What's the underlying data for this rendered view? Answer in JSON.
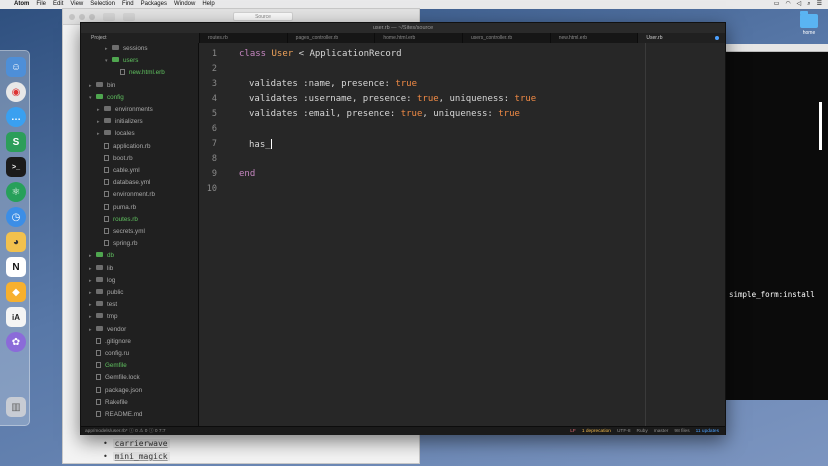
{
  "menubar": {
    "apple": "",
    "app": "Atom",
    "items": [
      "File",
      "Edit",
      "View",
      "Selection",
      "Find",
      "Packages",
      "Window",
      "Help"
    ]
  },
  "background_window": {
    "address": "Source",
    "bullets": [
      "carrierwave",
      "mini_magick"
    ]
  },
  "terminal": {
    "line": "simple_form:install"
  },
  "desktop": {
    "folder_label": "home"
  },
  "atom": {
    "title": "user.rb — ~/Sites/source",
    "project_tab": "Project",
    "tabs": [
      "routes.rb",
      "pages_controller.rb",
      "home.html.erb",
      "users_controller.rb",
      "new.html.erb",
      "User.rb"
    ],
    "tree": [
      {
        "label": "sessions",
        "type": "folder",
        "depth": 2,
        "expanded": false,
        "green": false
      },
      {
        "label": "users",
        "type": "folder",
        "depth": 2,
        "expanded": true,
        "green": true
      },
      {
        "label": "new.html.erb",
        "type": "file",
        "depth": 3,
        "green": true
      },
      {
        "label": "bin",
        "type": "folder",
        "depth": 0,
        "expanded": false,
        "green": false
      },
      {
        "label": "config",
        "type": "folder",
        "depth": 0,
        "expanded": true,
        "green": true
      },
      {
        "label": "environments",
        "type": "folder",
        "depth": 1,
        "expanded": false,
        "green": false
      },
      {
        "label": "initializers",
        "type": "folder",
        "depth": 1,
        "expanded": false,
        "green": false
      },
      {
        "label": "locales",
        "type": "folder",
        "depth": 1,
        "expanded": false,
        "green": false
      },
      {
        "label": "application.rb",
        "type": "file",
        "depth": 1,
        "green": false
      },
      {
        "label": "boot.rb",
        "type": "file",
        "depth": 1,
        "green": false
      },
      {
        "label": "cable.yml",
        "type": "file",
        "depth": 1,
        "green": false
      },
      {
        "label": "database.yml",
        "type": "file",
        "depth": 1,
        "green": false
      },
      {
        "label": "environment.rb",
        "type": "file",
        "depth": 1,
        "green": false
      },
      {
        "label": "puma.rb",
        "type": "file",
        "depth": 1,
        "green": false
      },
      {
        "label": "routes.rb",
        "type": "file",
        "depth": 1,
        "green": true
      },
      {
        "label": "secrets.yml",
        "type": "file",
        "depth": 1,
        "green": false
      },
      {
        "label": "spring.rb",
        "type": "file",
        "depth": 1,
        "green": false
      },
      {
        "label": "db",
        "type": "folder",
        "depth": 0,
        "expanded": false,
        "green": true
      },
      {
        "label": "lib",
        "type": "folder",
        "depth": 0,
        "expanded": false,
        "green": false
      },
      {
        "label": "log",
        "type": "folder",
        "depth": 0,
        "expanded": false,
        "green": false
      },
      {
        "label": "public",
        "type": "folder",
        "depth": 0,
        "expanded": false,
        "green": false
      },
      {
        "label": "test",
        "type": "folder",
        "depth": 0,
        "expanded": false,
        "green": false
      },
      {
        "label": "tmp",
        "type": "folder",
        "depth": 0,
        "expanded": false,
        "green": false
      },
      {
        "label": "vendor",
        "type": "folder",
        "depth": 0,
        "expanded": false,
        "green": false
      },
      {
        "label": ".gitignore",
        "type": "file",
        "depth": 0,
        "green": false
      },
      {
        "label": "config.ru",
        "type": "file",
        "depth": 0,
        "green": false
      },
      {
        "label": "Gemfile",
        "type": "file",
        "depth": 0,
        "green": true
      },
      {
        "label": "Gemfile.lock",
        "type": "file",
        "depth": 0,
        "green": false
      },
      {
        "label": "package.json",
        "type": "file",
        "depth": 0,
        "green": false
      },
      {
        "label": "Rakefile",
        "type": "file",
        "depth": 0,
        "green": false
      },
      {
        "label": "README.md",
        "type": "file",
        "depth": 0,
        "green": false
      }
    ],
    "line_numbers": [
      "1",
      "2",
      "3",
      "4",
      "5",
      "6",
      "7",
      "8",
      "9",
      "10"
    ],
    "code": {
      "l1_kw": "class",
      "l1_cls": "User",
      "l1_rest": " < ApplicationRecord",
      "l3": "validates :name, presence: ",
      "l4a": "validates :username, presence: ",
      "l4b": ", uniqueness: ",
      "l5a": "validates :email, presence: ",
      "l5b": ", uniqueness: ",
      "bool": "true",
      "l7": "has_",
      "l9": "end"
    },
    "status": {
      "left": "app/models/user.rb*   ⓘ 0  ⚠ 0  ⓘ 0    7:7",
      "lf": "LF",
      "deprecation": "1 deprecation",
      "encoding": "UTF-8",
      "grammar": "Ruby",
      "branch": "master",
      "files": "98 files",
      "updates": "11 updates"
    }
  }
}
